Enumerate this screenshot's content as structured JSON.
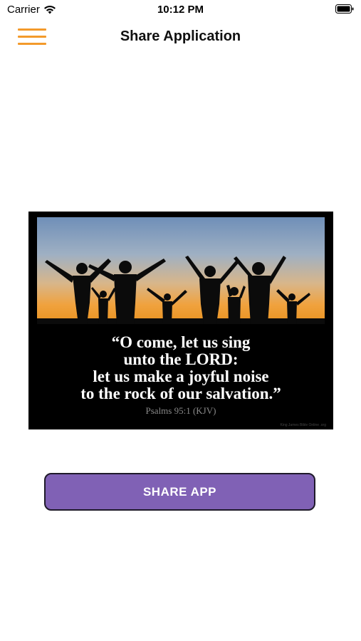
{
  "status_bar": {
    "carrier": "Carrier",
    "time": "10:12 PM",
    "wifi_icon": "wifi-icon",
    "battery_icon": "battery-icon"
  },
  "nav": {
    "title": "Share Application",
    "menu_icon": "hamburger-menu-icon",
    "menu_color": "#f39a2b"
  },
  "poster": {
    "verse_lines": [
      "“O come, let us sing",
      "unto the LORD:",
      "let us make a joyful noise",
      "to the rock of our salvation.”"
    ],
    "reference": "Psalms 95:1 (KJV)",
    "watermark": "King James Bible Online .org"
  },
  "share_button": {
    "label": "SHARE APP",
    "color": "#8061b5"
  }
}
